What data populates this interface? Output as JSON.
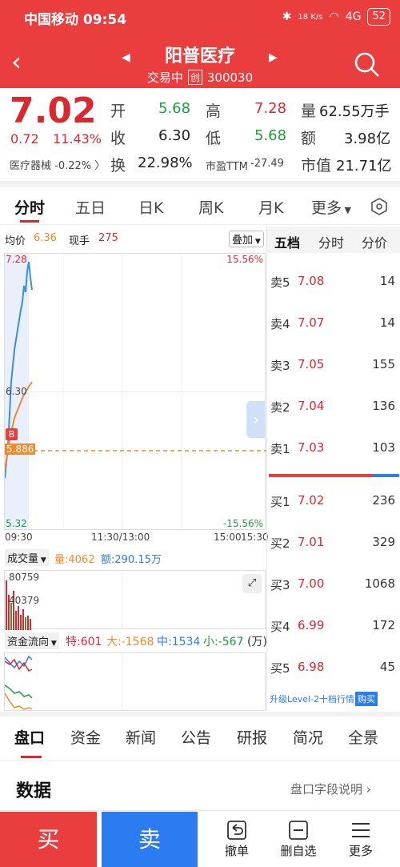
{
  "status": {
    "carrier": "中国移动",
    "time": "09:54",
    "net_speed": "18 K/s",
    "signal": "4G",
    "battery": "52"
  },
  "header": {
    "stock_name": "阳普医疗",
    "trade_status": "交易中",
    "board_tag": "创",
    "stock_code": "300030"
  },
  "quote": {
    "price": "7.02",
    "change": "0.72",
    "change_pct": "11.43%",
    "sector": "医疗器械 -0.22%",
    "sector_arrow": "〉",
    "open_label": "开",
    "open": "5.68",
    "high_label": "高",
    "high": "7.28",
    "volume_label": "量",
    "volume": "62.55万手",
    "close_label": "收",
    "close": "6.30",
    "low_label": "低",
    "low": "5.68",
    "amount_label": "额",
    "amount": "3.98亿",
    "turnover_label": "换",
    "turnover": "22.98%",
    "pe_label": "市盈TTM",
    "pe": "-27.49",
    "mcap_label": "市值",
    "mcap": "21.71亿"
  },
  "tabs": [
    "分时",
    "五日",
    "日K",
    "周K",
    "月K",
    "更多"
  ],
  "chart": {
    "avg_label": "均价",
    "avg_value": "6.36",
    "hand_label": "现手",
    "hand_value": "275",
    "overlay_btn": "叠加",
    "y_top": "7.28",
    "y_mid": "6.30",
    "y_bottom": "5.32",
    "pct_top": "15.56%",
    "pct_bottom": "-15.56%",
    "cursor_price": "5.886",
    "b_marker": "B",
    "t0": "09:30",
    "t1": "11:30/13:00",
    "t2": "15:00",
    "t3": "15:30",
    "volume_sel": "成交量",
    "vol_label": "量:4062",
    "amt_label": "额:290.15万",
    "vol_max": "80759",
    "vol_mid": "40379",
    "flow_sel": "资金流向",
    "flow_te": "特:601",
    "flow_da": "大:-1568",
    "flow_zhong": "中:1534",
    "flow_xiao": "小:-567",
    "flow_unit": "(万)"
  },
  "book": {
    "tabs": [
      "五档",
      "分时",
      "分价"
    ],
    "asks": [
      {
        "label": "卖5",
        "price": "7.08",
        "vol": "14"
      },
      {
        "label": "卖4",
        "price": "7.07",
        "vol": "14"
      },
      {
        "label": "卖3",
        "price": "7.05",
        "vol": "155"
      },
      {
        "label": "卖2",
        "price": "7.04",
        "vol": "136"
      },
      {
        "label": "卖1",
        "price": "7.03",
        "vol": "103"
      }
    ],
    "bids": [
      {
        "label": "买1",
        "price": "7.02",
        "vol": "236"
      },
      {
        "label": "买2",
        "price": "7.01",
        "vol": "329"
      },
      {
        "label": "买3",
        "price": "7.00",
        "vol": "1068"
      },
      {
        "label": "买4",
        "price": "6.99",
        "vol": "172"
      },
      {
        "label": "买5",
        "price": "6.98",
        "vol": "45"
      }
    ],
    "upgrade_text": "升级Level-2十档行情",
    "buy_tag": "购买"
  },
  "bottom_tabs": [
    "盘口",
    "资金",
    "新闻",
    "公告",
    "研报",
    "简况",
    "全景"
  ],
  "section": {
    "title": "数据",
    "link": "盘口字段说明"
  },
  "actions": {
    "buy": "买",
    "sell": "卖",
    "cancel": "撤单",
    "delete_fav": "删自选",
    "more": "更多"
  },
  "colors": {
    "header": "#ea3d3d",
    "up": "#d9292e",
    "down": "#1f9e3a",
    "sell_btn": "#2a7cf0",
    "price_line": "#3b8fe0",
    "avg_line": "#f08a2c"
  }
}
